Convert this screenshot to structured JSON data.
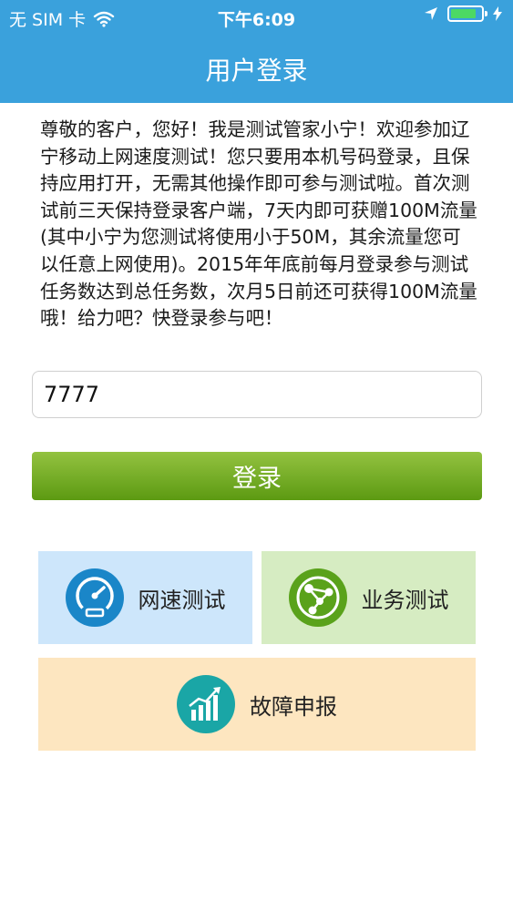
{
  "status_bar": {
    "carrier": "无 SIM 卡",
    "time": "下午6:09"
  },
  "header": {
    "title": "用户登录"
  },
  "intro_text": "尊敬的客户，您好！我是测试管家小宁！欢迎参加辽宁移动上网速度测试！您只要用本机号码登录，且保持应用打开，无需其他操作即可参与测试啦。首次测试前三天保持登录客户端，7天内即可获赠100M流量(其中小宁为您测试将使用小于50M，其余流量您可以任意上网使用)。2015年年底前每月登录参与测试任务数达到总任务数，次月5日前还可获得100M流量哦！给力吧？快登录参与吧！",
  "phone_input": {
    "value": "7777"
  },
  "login_button": {
    "label": "登录"
  },
  "tiles": {
    "speed_test": {
      "label": "网速测试",
      "icon": "speedometer-icon",
      "bg": "#cde6fb",
      "icon_color": "#1a86c8"
    },
    "service_test": {
      "label": "业务测试",
      "icon": "network-icon",
      "bg": "#d6ecc2",
      "icon_color": "#5aa21b"
    },
    "fault_report": {
      "label": "故障申报",
      "icon": "chart-up-icon",
      "bg": "#fde6c0",
      "icon_color": "#1aa6a6"
    }
  },
  "colors": {
    "header": "#3aa1dc",
    "login_button": "#6faa1e",
    "battery_fill": "#4cd964"
  },
  "battery_level": 0.85
}
